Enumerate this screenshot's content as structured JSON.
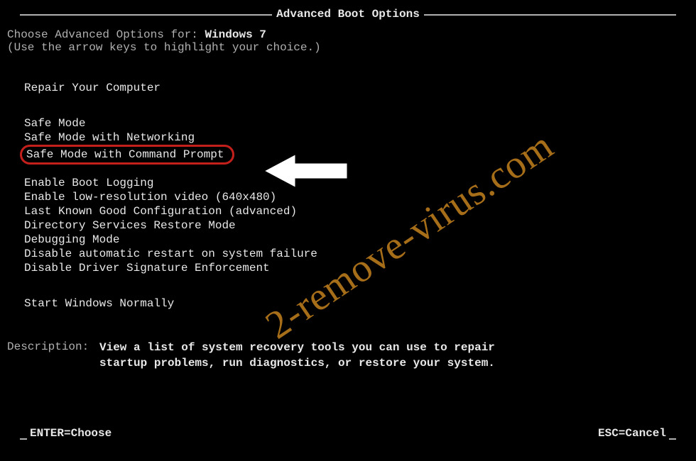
{
  "title": "Advanced Boot Options",
  "intro": {
    "prefix": "Choose Advanced Options for: ",
    "os": "Windows 7",
    "hint": "(Use the arrow keys to highlight your choice.)"
  },
  "groups": {
    "repair": [
      "Repair Your Computer"
    ],
    "safe": [
      "Safe Mode",
      "Safe Mode with Networking",
      "Safe Mode with Command Prompt"
    ],
    "misc": [
      "Enable Boot Logging",
      "Enable low-resolution video (640x480)",
      "Last Known Good Configuration (advanced)",
      "Directory Services Restore Mode",
      "Debugging Mode",
      "Disable automatic restart on system failure",
      "Disable Driver Signature Enforcement"
    ],
    "normal": [
      "Start Windows Normally"
    ]
  },
  "highlighted_index": 2,
  "description": {
    "label": "Description:",
    "text": "View a list of system recovery tools you can use to repair startup problems, run diagnostics, or restore your system."
  },
  "footer": {
    "enter": "ENTER=Choose",
    "esc": "ESC=Cancel"
  },
  "watermark": "2-remove-virus.com"
}
